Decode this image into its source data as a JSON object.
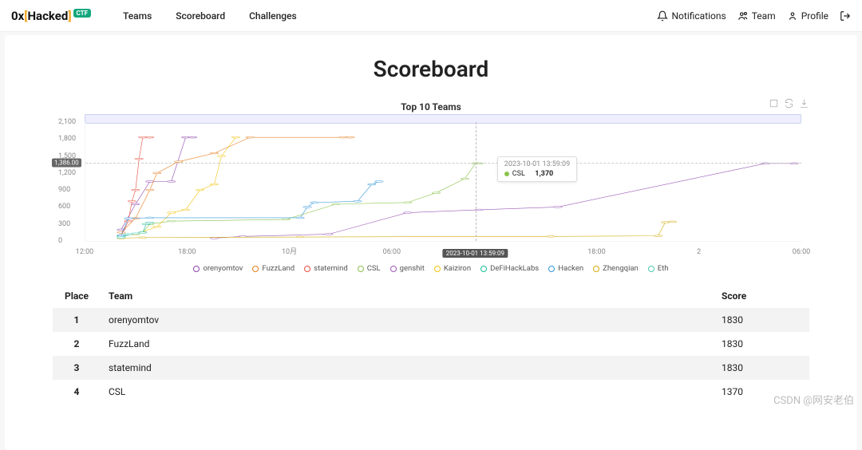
{
  "brand": {
    "prefix": "0x",
    "open": "[",
    "name": "Hacked",
    "close": "]",
    "badge": "CTF"
  },
  "nav": {
    "items": [
      "Teams",
      "Scoreboard",
      "Challenges"
    ]
  },
  "nav_right": {
    "notifications": "Notifications",
    "team": "Team",
    "profile": "Profile"
  },
  "page_title": "Scoreboard",
  "chart_data": {
    "type": "line",
    "title": "Top 10 Teams",
    "ylabel": "",
    "xlabel": "",
    "ylim": [
      0,
      2100
    ],
    "yticks": [
      0,
      300,
      600,
      900,
      1200,
      1500,
      1800,
      2100
    ],
    "y_marker": {
      "value": 1386.0,
      "label": "1,386.00"
    },
    "x_categories": [
      "12:00",
      "18:00",
      "10月",
      "06:00",
      "",
      "18:00",
      "2",
      "06:00"
    ],
    "x_highlight": {
      "index_pos": 0.545,
      "label": "2023-10-01 13:59:09"
    },
    "tooltip": {
      "time": "2023-10-01 13:59:09",
      "series": "CSL",
      "value": "1,370",
      "color": "#8bc34a"
    },
    "legend": [
      {
        "name": "orenyomtov",
        "color": "#8e44ad"
      },
      {
        "name": "FuzzLand",
        "color": "#e67e22"
      },
      {
        "name": "statemind",
        "color": "#e74c3c"
      },
      {
        "name": "CSL",
        "color": "#8bc34a"
      },
      {
        "name": "genshit",
        "color": "#9b59b6"
      },
      {
        "name": "Kaiziron",
        "color": "#f1c40f"
      },
      {
        "name": "DeFiHackLabs",
        "color": "#1abc9c"
      },
      {
        "name": "Hacken",
        "color": "#3498db"
      },
      {
        "name": "Zhengqian",
        "color": "#d4ac0d"
      },
      {
        "name": "Eth",
        "color": "#48c9b0"
      }
    ],
    "series": [
      {
        "name": "orenyomtov",
        "color": "#8e44ad",
        "points": [
          [
            0.05,
            200
          ],
          [
            0.07,
            650
          ],
          [
            0.09,
            1050
          ],
          [
            0.12,
            1050
          ],
          [
            0.14,
            1830
          ],
          [
            0.15,
            1830
          ]
        ]
      },
      {
        "name": "FuzzLand",
        "color": "#e67e22",
        "points": [
          [
            0.05,
            150
          ],
          [
            0.07,
            400
          ],
          [
            0.09,
            900
          ],
          [
            0.1,
            1200
          ],
          [
            0.13,
            1400
          ],
          [
            0.18,
            1550
          ],
          [
            0.23,
            1830
          ],
          [
            0.36,
            1830
          ],
          [
            0.37,
            1830
          ]
        ]
      },
      {
        "name": "statemind",
        "color": "#e74c3c",
        "points": [
          [
            0.05,
            100
          ],
          [
            0.06,
            350
          ],
          [
            0.065,
            700
          ],
          [
            0.07,
            900
          ],
          [
            0.075,
            1450
          ],
          [
            0.08,
            1830
          ],
          [
            0.09,
            1830
          ]
        ]
      },
      {
        "name": "CSL",
        "color": "#8bc34a",
        "points": [
          [
            0.05,
            100
          ],
          [
            0.08,
            150
          ],
          [
            0.09,
            300
          ],
          [
            0.12,
            350
          ],
          [
            0.28,
            380
          ],
          [
            0.35,
            650
          ],
          [
            0.45,
            680
          ],
          [
            0.49,
            850
          ],
          [
            0.53,
            1100
          ],
          [
            0.545,
            1370
          ],
          [
            0.55,
            1370
          ]
        ]
      },
      {
        "name": "genshit",
        "color": "#9b59b6",
        "points": [
          [
            0.18,
            50
          ],
          [
            0.22,
            80
          ],
          [
            0.34,
            120
          ],
          [
            0.45,
            500
          ],
          [
            0.55,
            550
          ],
          [
            0.66,
            600
          ],
          [
            0.95,
            1370
          ],
          [
            0.99,
            1370
          ]
        ]
      },
      {
        "name": "Kaiziron",
        "color": "#f1c40f",
        "points": [
          [
            0.07,
            120
          ],
          [
            0.1,
            250
          ],
          [
            0.12,
            500
          ],
          [
            0.14,
            550
          ],
          [
            0.16,
            900
          ],
          [
            0.18,
            1000
          ],
          [
            0.19,
            1500
          ],
          [
            0.21,
            1830
          ]
        ]
      },
      {
        "name": "DeFiHackLabs",
        "color": "#1abc9c",
        "points": [
          [
            0.05,
            80
          ],
          [
            0.08,
            150
          ],
          [
            0.085,
            300
          ],
          [
            0.09,
            320
          ]
        ]
      },
      {
        "name": "Hacken",
        "color": "#3498db",
        "points": [
          [
            0.05,
            100
          ],
          [
            0.06,
            400
          ],
          [
            0.09,
            410
          ],
          [
            0.3,
            410
          ],
          [
            0.31,
            600
          ],
          [
            0.32,
            680
          ],
          [
            0.38,
            700
          ],
          [
            0.4,
            1000
          ],
          [
            0.41,
            1050
          ]
        ]
      },
      {
        "name": "Zhengqian",
        "color": "#d4ac0d",
        "points": [
          [
            0.05,
            50
          ],
          [
            0.08,
            60
          ],
          [
            0.3,
            70
          ],
          [
            0.65,
            80
          ],
          [
            0.8,
            90
          ],
          [
            0.81,
            330
          ],
          [
            0.82,
            340
          ]
        ]
      },
      {
        "name": "Eth",
        "color": "#48c9b0",
        "points": [
          [
            0.05,
            60
          ],
          [
            0.06,
            120
          ],
          [
            0.07,
            130
          ]
        ]
      }
    ]
  },
  "table": {
    "headers": [
      "Place",
      "Team",
      "Score"
    ],
    "rows": [
      {
        "place": "1",
        "team": "orenyomtov",
        "score": "1830"
      },
      {
        "place": "2",
        "team": "FuzzLand",
        "score": "1830"
      },
      {
        "place": "3",
        "team": "statemind",
        "score": "1830"
      },
      {
        "place": "4",
        "team": "CSL",
        "score": "1370"
      }
    ]
  },
  "watermark": "CSDN @网安老伯"
}
